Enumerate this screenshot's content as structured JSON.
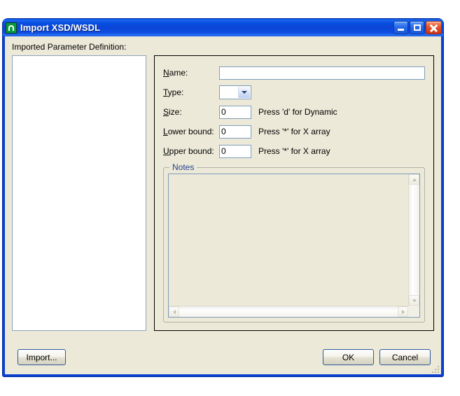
{
  "window": {
    "title": "Import XSD/WSDL",
    "icon": "app-icon",
    "controls": {
      "minimize": "minimize-icon",
      "maximize": "maximize-icon",
      "close": "close-icon"
    }
  },
  "body": {
    "imported_label": "Imported Parameter Definition:",
    "tree_items": []
  },
  "form": {
    "name": {
      "label": "Name:",
      "mnemonic": "N",
      "value": "",
      "placeholder": ""
    },
    "type": {
      "label": "Type:",
      "mnemonic": "T",
      "value": "",
      "options": []
    },
    "size": {
      "label": "Size:",
      "mnemonic": "S",
      "value": "0",
      "hint": "Press 'd' for Dynamic"
    },
    "lower_bound": {
      "label": "Lower bound:",
      "mnemonic": "L",
      "value": "0",
      "hint": "Press '*' for X array"
    },
    "upper_bound": {
      "label": "Upper bound:",
      "mnemonic": "U",
      "value": "0",
      "hint": "Press '*' for X array"
    }
  },
  "notes": {
    "legend": "Notes",
    "value": "",
    "scroll_up": "scroll-up-icon",
    "scroll_down": "scroll-down-icon",
    "scroll_left": "scroll-left-icon",
    "scroll_right": "scroll-right-icon"
  },
  "buttons": {
    "import": "Import...",
    "ok": "OK",
    "cancel": "Cancel"
  },
  "colors": {
    "title_bar": "#0a4fe0",
    "dialog_face": "#ece9d8",
    "field_border": "#7f9db9",
    "legend_text": "#21428f",
    "button_border": "#2d5a9e",
    "icon_green": "#0c9b3f",
    "close_red": "#e6512a"
  }
}
